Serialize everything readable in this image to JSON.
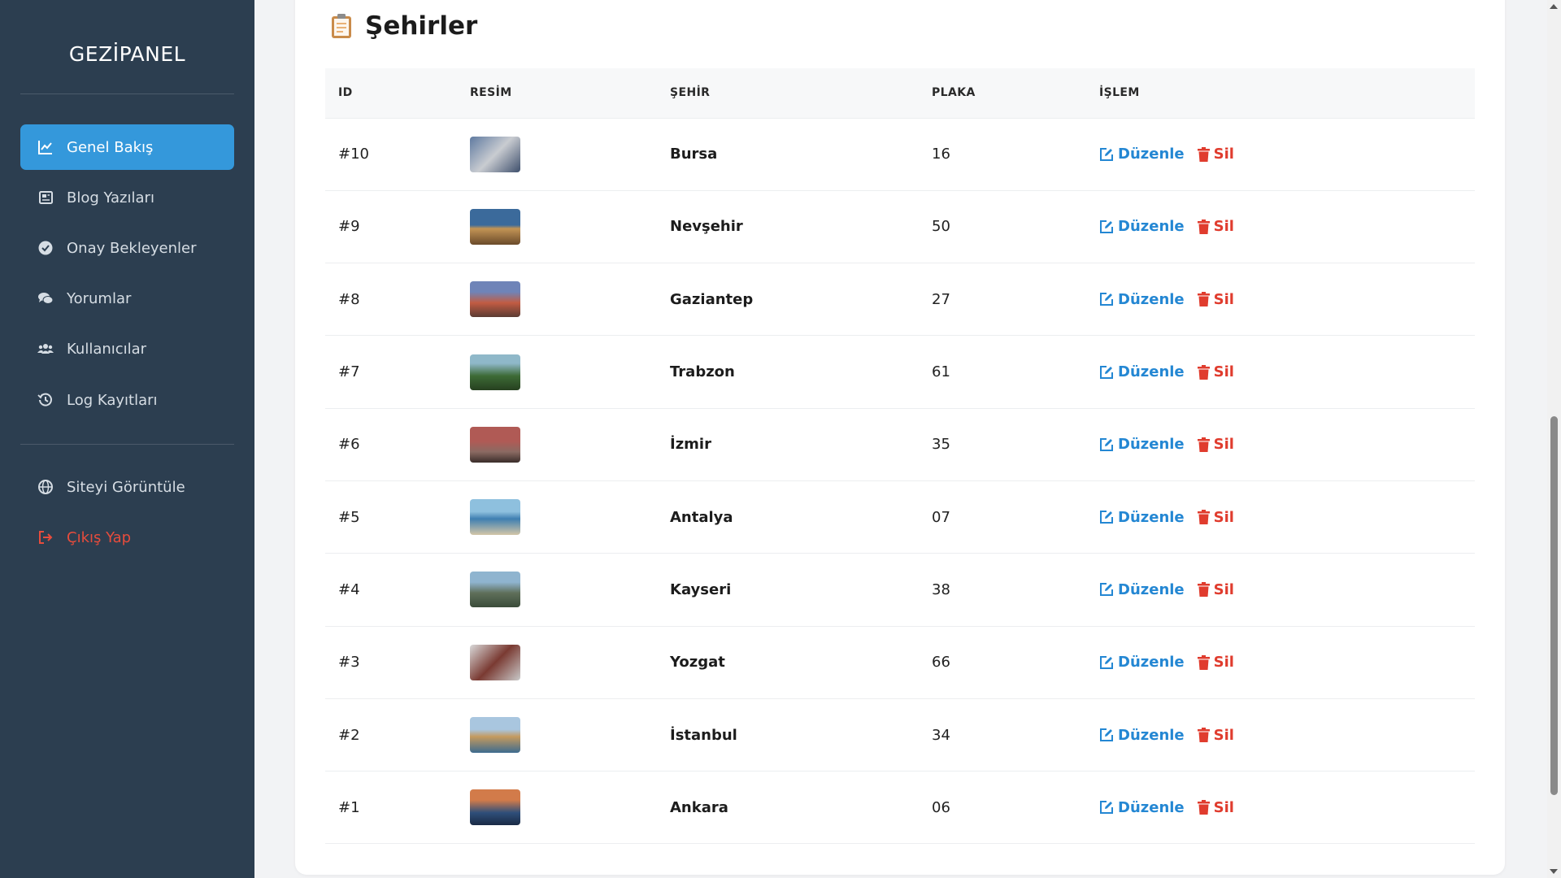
{
  "sidebar": {
    "brand": "GEZİPANEL",
    "items": [
      {
        "label": "Genel Bakış",
        "icon": "chart-line-icon",
        "active": true
      },
      {
        "label": "Blog Yazıları",
        "icon": "newspaper-icon"
      },
      {
        "label": "Onay Bekleyenler",
        "icon": "check-circle-icon"
      },
      {
        "label": "Yorumlar",
        "icon": "comments-icon"
      },
      {
        "label": "Kullanıcılar",
        "icon": "users-icon"
      },
      {
        "label": "Log Kayıtları",
        "icon": "history-icon"
      }
    ],
    "secondary": [
      {
        "label": "Siteyi Görüntüle",
        "icon": "globe-icon"
      },
      {
        "label": "Çıkış Yap",
        "icon": "sign-out-icon",
        "color": "#e74c3c"
      }
    ]
  },
  "page": {
    "title": "Şehirler",
    "title_icon": "clipboard-icon"
  },
  "table": {
    "headers": [
      "ID",
      "RESİM",
      "ŞEHİR",
      "PLAKA",
      "İŞLEM"
    ],
    "edit_label": "Düzenle",
    "delete_label": "Sil",
    "rows": [
      {
        "id": "#10",
        "city": "Bursa",
        "plate": "16"
      },
      {
        "id": "#9",
        "city": "Nevşehir",
        "plate": "50"
      },
      {
        "id": "#8",
        "city": "Gaziantep",
        "plate": "27"
      },
      {
        "id": "#7",
        "city": "Trabzon",
        "plate": "61"
      },
      {
        "id": "#6",
        "city": "İzmir",
        "plate": "35"
      },
      {
        "id": "#5",
        "city": "Antalya",
        "plate": "07"
      },
      {
        "id": "#4",
        "city": "Kayseri",
        "plate": "38"
      },
      {
        "id": "#3",
        "city": "Yozgat",
        "plate": "66"
      },
      {
        "id": "#2",
        "city": "İstanbul",
        "plate": "34"
      },
      {
        "id": "#1",
        "city": "Ankara",
        "plate": "06"
      }
    ]
  },
  "colors": {
    "sidebar_bg": "#2c3e50",
    "accent": "#3498db",
    "edit": "#2487d3",
    "delete": "#e03c2e"
  }
}
